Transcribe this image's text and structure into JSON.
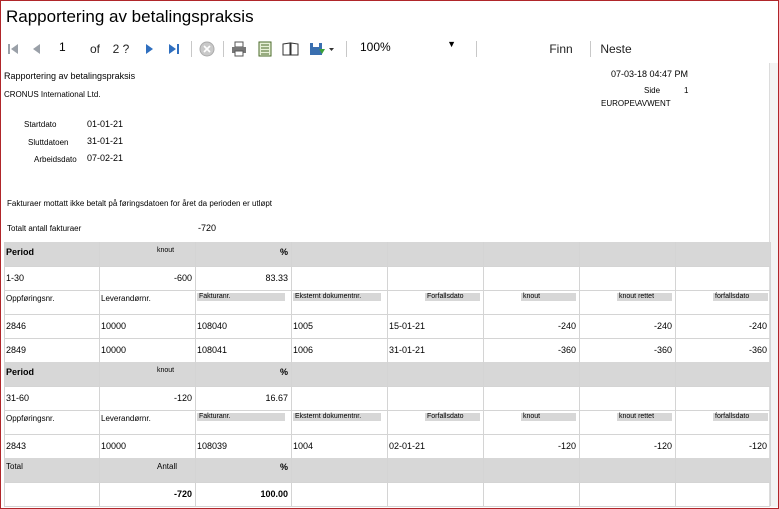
{
  "window": {
    "title": "Rapportering av betalingspraksis"
  },
  "toolbar": {
    "page_current": "1",
    "page_of": "of",
    "page_total": "2 ?",
    "zoom": "100%",
    "find_label": "Finn",
    "next_label": "Neste"
  },
  "report": {
    "title": "Rapportering av betalingspraksis",
    "company": "CRONUS International Ltd.",
    "datetime": "07-03-18 04:47 PM",
    "page_label": "Side",
    "page_value": "1",
    "user": "EUROPE\\AVWENT",
    "params": [
      {
        "label": "Startdato",
        "value": "01-01-21"
      },
      {
        "label": "Sluttdatoen",
        "value": "31-01-21"
      },
      {
        "label": "Arbeidsdato",
        "value": "07-02-21"
      }
    ],
    "note": "Fakturaer mottatt ikke betalt på føringsdatoen for året da perioden er utløpt",
    "total_label": "Totalt antall fakturaer",
    "total_value": "-720",
    "period_header": {
      "period": "Period",
      "amount": "knout",
      "pct": "%"
    },
    "line_headers": [
      "Oppføringsnr.",
      "Leverandørnr.",
      "Fakturanr.",
      "Eksternt dokumentnr.",
      "Forfallsdato",
      "knout",
      "knout rettet",
      "forfallsdato"
    ],
    "groups": [
      {
        "period": "1-30",
        "amount": "-600",
        "pct": "83.33",
        "rows": [
          [
            "2846",
            "10000",
            "108040",
            "1005",
            "15-01-21",
            "-240",
            "-240",
            "-240"
          ],
          [
            "2849",
            "10000",
            "108041",
            "1006",
            "31-01-21",
            "-360",
            "-360",
            "-360"
          ]
        ]
      },
      {
        "period": "31-60",
        "amount": "-120",
        "pct": "16.67",
        "rows": [
          [
            "2843",
            "10000",
            "108039",
            "1004",
            "02-01-21",
            "-120",
            "-120",
            "-120"
          ]
        ]
      }
    ],
    "summary": {
      "total_label": "Total",
      "count_label": "Antall",
      "pct_label": "%",
      "count_value": "-720",
      "pct_value": "100.00"
    }
  }
}
